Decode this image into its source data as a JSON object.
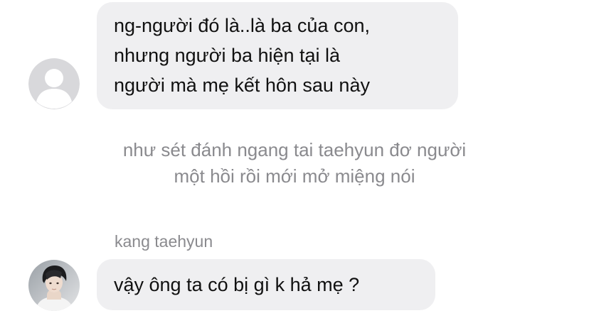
{
  "messages": [
    {
      "avatar_icon": "default-user-icon",
      "lines": [
        "ng-người đó là..là ba của con,",
        "nhưng người ba hiện tại là",
        "người mà mẹ kết hôn sau này"
      ]
    }
  ],
  "system_message": {
    "lines": [
      "như sét đánh ngang tai taehyun đơ người",
      "một hồi rồi mới mở miệng nói"
    ]
  },
  "reply": {
    "sender": "kang taehyun",
    "avatar_icon": "profile-photo-icon",
    "text": "vậy ông ta có bị gì k hả mẹ ?"
  },
  "colors": {
    "bubble": "#efeff1",
    "text": "#111111",
    "muted": "#8a8a8e",
    "default_avatar_bg": "#d8d8db"
  }
}
